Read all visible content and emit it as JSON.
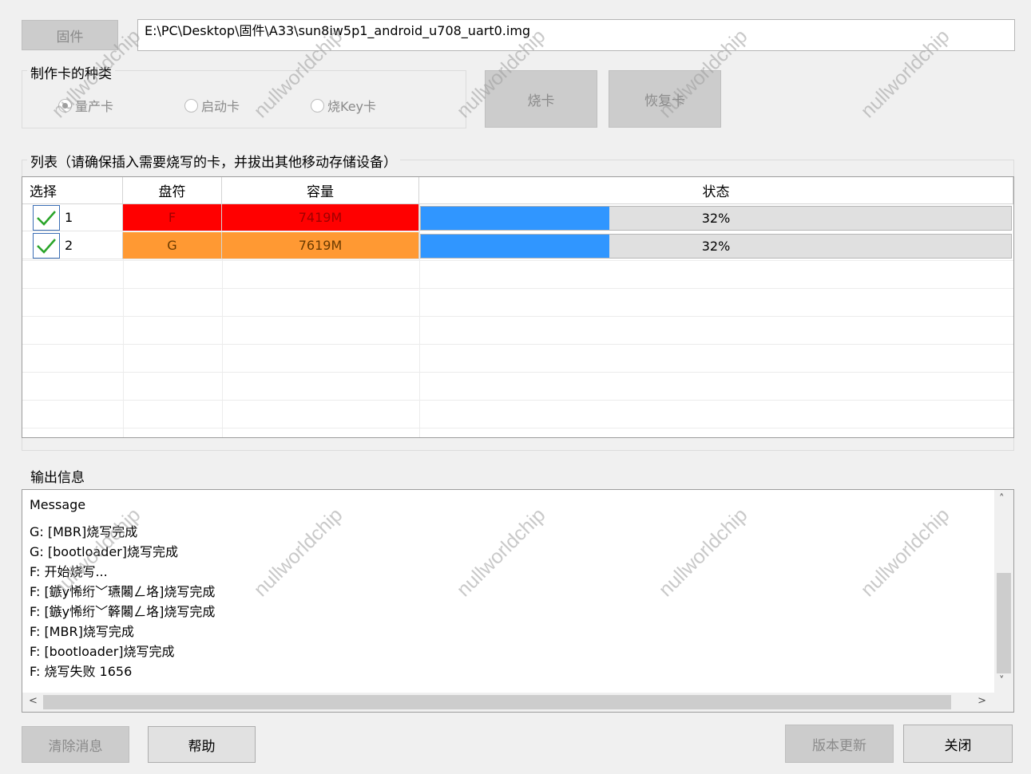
{
  "top": {
    "firmware_button": "固件",
    "firmware_path": "E:\\PC\\Desktop\\固件\\A33\\sun8iw5p1_android_u708_uart0.img"
  },
  "card_type": {
    "group_label": "制作卡的种类",
    "options": [
      {
        "label": "量产卡",
        "selected": true
      },
      {
        "label": "启动卡",
        "selected": false
      },
      {
        "label": "烧Key卡",
        "selected": false
      }
    ],
    "burn_button": "烧卡",
    "restore_button": "恢复卡"
  },
  "list": {
    "group_label": "列表（请确保插入需要烧写的卡，并拔出其他移动存储设备）",
    "columns": [
      "选择",
      "盘符",
      "容量",
      "状态"
    ],
    "rows": [
      {
        "index": "1",
        "checked": true,
        "drive": "F",
        "capacity": "7419M",
        "progress": 0.32,
        "status": "32%",
        "color": "#ff0000"
      },
      {
        "index": "2",
        "checked": true,
        "drive": "G",
        "capacity": "7619M",
        "progress": 0.32,
        "status": "32%",
        "color": "#ff9933"
      }
    ]
  },
  "output": {
    "group_label": "输出信息",
    "lines": [
      "Message",
      "G: [MBR]烧写完成",
      "G: [bootloader]烧写完成",
      "F: 开始烧写...",
      "F: [鏃у悕绗﹀瓙闂ㄥ垎]烧写完成",
      "F: [鏃у悕绗﹀簳闂ㄥ垎]烧写完成",
      "F: [MBR]烧写完成",
      "F: [bootloader]烧写完成",
      "F: 烧写失败 1656"
    ]
  },
  "bottom": {
    "clear_button": "清除消息",
    "help_button": "帮助",
    "update_button": "版本更新",
    "close_button": "关闭"
  },
  "watermark": "nullworldchip",
  "colors": {
    "progress": "#3096ff",
    "background": "#f0f0f0"
  }
}
